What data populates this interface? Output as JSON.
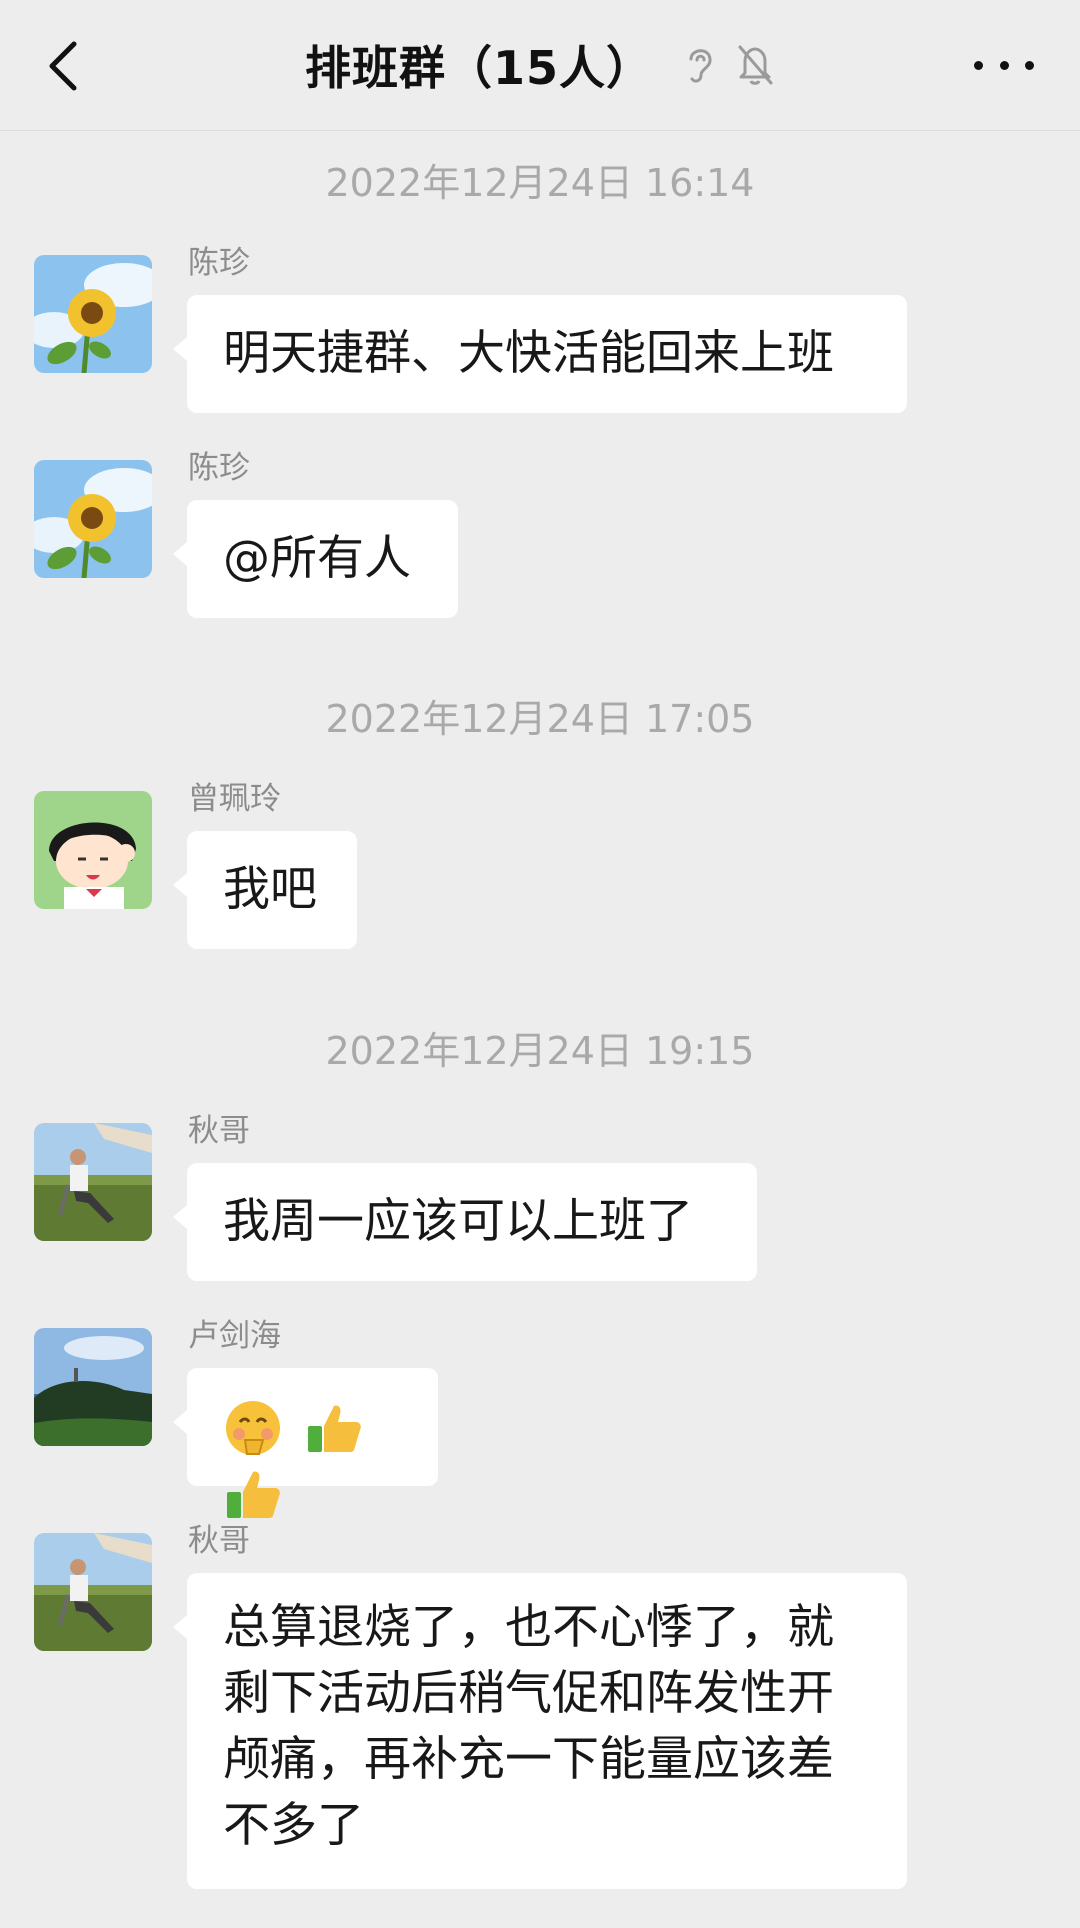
{
  "header": {
    "title": "排班群（15人）",
    "icons": [
      "ear-icon",
      "muted-bell-icon"
    ]
  },
  "timestamps": {
    "t1": "2022年12月24日 16:14",
    "t2": "2022年12月24日 17:05",
    "t3": "2022年12月24日 19:15"
  },
  "messages": [
    {
      "sender": "陈珍",
      "text": "明天捷群、大快活能回来上班",
      "avatar": "sunflower"
    },
    {
      "sender": "陈珍",
      "text": "@所有人",
      "avatar": "sunflower"
    },
    {
      "sender": "曾珮玲",
      "text": "我吧",
      "avatar": "cartoon-girl"
    },
    {
      "sender": "秋哥",
      "text": "我周一应该可以上班了",
      "avatar": "man-on-grass"
    },
    {
      "sender": "卢剑海",
      "text": "",
      "emojis": [
        "shy-face",
        "thumbs-up",
        "thumbs-up"
      ],
      "avatar": "coast"
    },
    {
      "sender": "秋哥",
      "text": "总算退烧了，也不心悸了，就剩下活动后稍气促和阵发性开颅痛，再补充一下能量应该差不多了",
      "avatar": "man-on-grass"
    }
  ],
  "colors": {
    "background": "#ededed",
    "bubble": "#ffffff",
    "timestamp": "#a9a9a9",
    "sender": "#8c8c8c"
  }
}
